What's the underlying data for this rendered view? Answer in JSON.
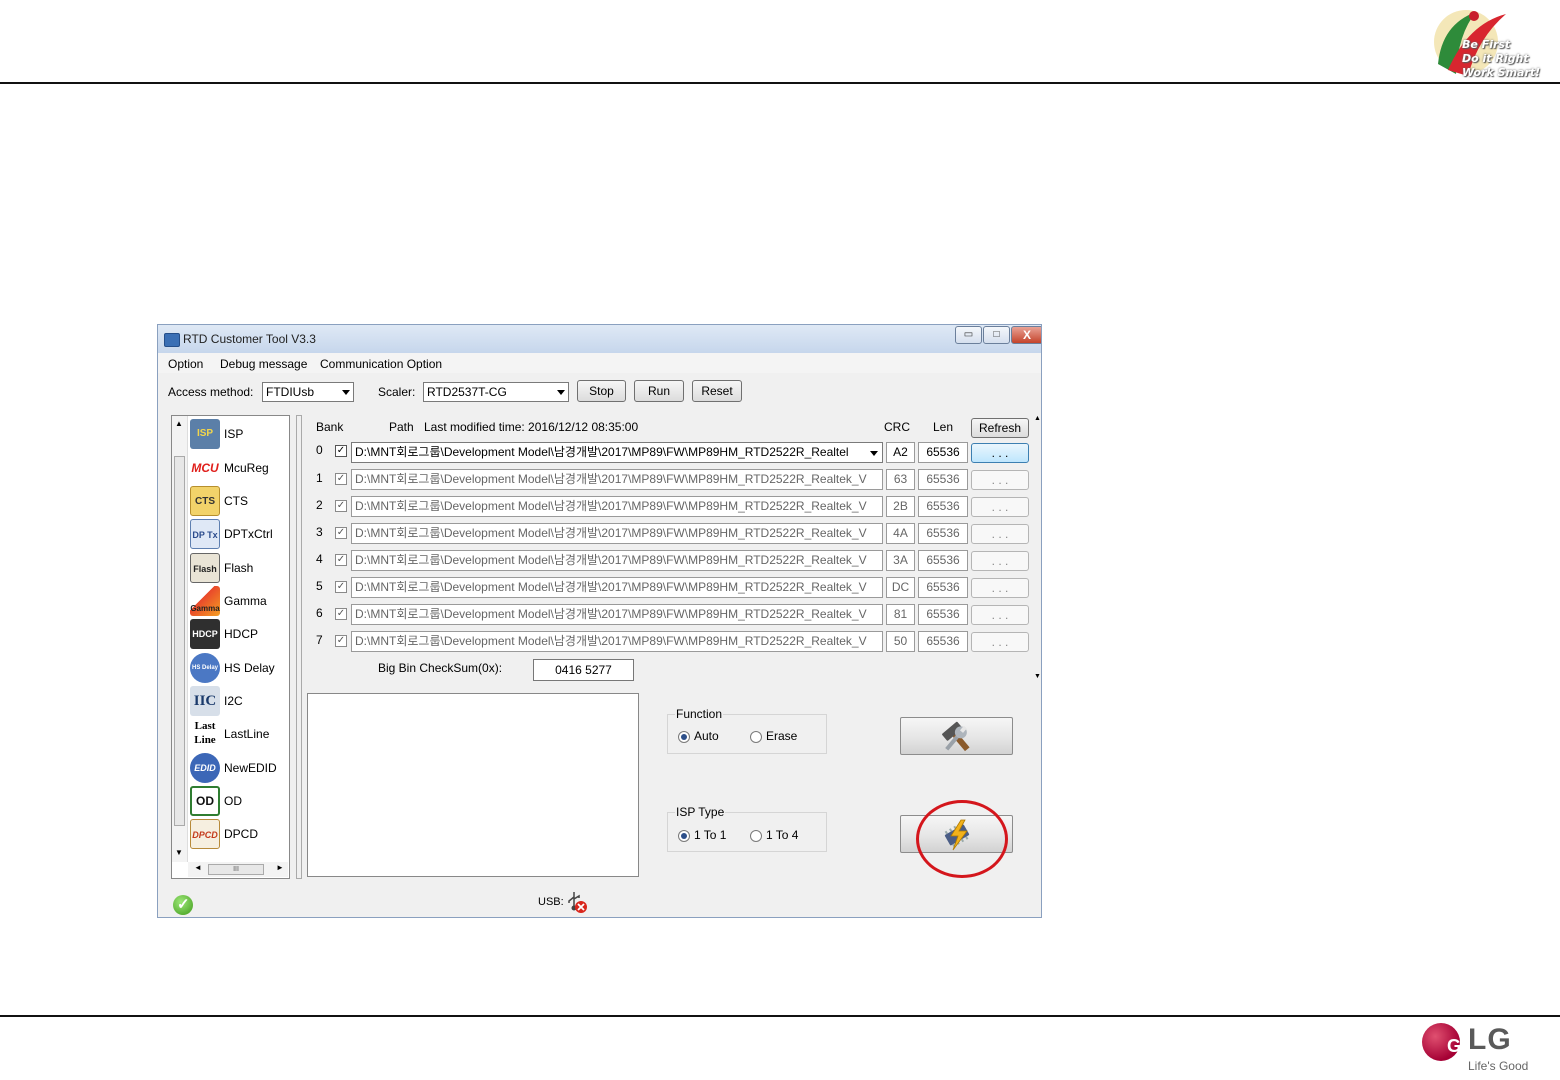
{
  "slide": {
    "slogan": [
      "Be First",
      "Do it Right",
      "Work Smart!"
    ],
    "brand": {
      "word": "LG",
      "face": "G",
      "tagline": "Life's Good"
    }
  },
  "window": {
    "title": "RTD Customer Tool V3.3",
    "controls": {
      "minimize": "▭",
      "maximize": "□",
      "close": "X"
    },
    "menu": [
      "Option",
      "Debug message",
      "Communication Option"
    ],
    "toolbar": {
      "access_label": "Access method:",
      "access_value": "FTDIUsb",
      "scaler_label": "Scaler:",
      "scaler_value": "RTD2537T-CG",
      "stop": "Stop",
      "run": "Run",
      "reset": "Reset"
    },
    "tree": {
      "items": [
        {
          "label": "ISP",
          "icon": "isp-icon"
        },
        {
          "label": "McuReg",
          "icon": "mcu-icon"
        },
        {
          "label": "CTS",
          "icon": "cts-icon"
        },
        {
          "label": "DPTxCtrl",
          "icon": "dptx-icon"
        },
        {
          "label": "Flash",
          "icon": "flash-icon"
        },
        {
          "label": "Gamma",
          "icon": "gamma-icon"
        },
        {
          "label": "HDCP",
          "icon": "hdcp-icon"
        },
        {
          "label": "HS Delay",
          "icon": "hsdelay-icon"
        },
        {
          "label": "I2C",
          "icon": "i2c-icon"
        },
        {
          "label": "LastLine",
          "icon": "lastline-icon"
        },
        {
          "label": "NewEDID",
          "icon": "edid-icon"
        },
        {
          "label": "OD",
          "icon": "od-icon"
        },
        {
          "label": "DPCD",
          "icon": "dpcd-icon"
        }
      ],
      "icon_text": [
        "ISP",
        "MCU",
        "CTS",
        "DP Tx",
        "Flash",
        "Gamma",
        "HDCP",
        "HS Delay",
        "IIC",
        "Last Line",
        "EDID",
        "OD",
        "DPCD"
      ],
      "scroll_grip": "III"
    },
    "grid": {
      "headers": {
        "bank": "Bank",
        "path": "Path",
        "modified": "Last modified time: 2016/12/12 08:35:00",
        "crc": "CRC",
        "len": "Len",
        "refresh": "Refresh"
      },
      "rows": [
        {
          "bank": "0",
          "path": "D:\\MNT회로그룹\\Development Model\\남경개발\\2017\\MP89\\FW\\MP89HM_RTD2522R_Realtel",
          "crc": "A2",
          "len": "65536",
          "browse": ". . ."
        },
        {
          "bank": "1",
          "path": "D:\\MNT회로그룹\\Development Model\\남경개발\\2017\\MP89\\FW\\MP89HM_RTD2522R_Realtek_V",
          "crc": "63",
          "len": "65536",
          "browse": ". . ."
        },
        {
          "bank": "2",
          "path": "D:\\MNT회로그룹\\Development Model\\남경개발\\2017\\MP89\\FW\\MP89HM_RTD2522R_Realtek_V",
          "crc": "2B",
          "len": "65536",
          "browse": ". . ."
        },
        {
          "bank": "3",
          "path": "D:\\MNT회로그룹\\Development Model\\남경개발\\2017\\MP89\\FW\\MP89HM_RTD2522R_Realtek_V",
          "crc": "4A",
          "len": "65536",
          "browse": ". . ."
        },
        {
          "bank": "4",
          "path": "D:\\MNT회로그룹\\Development Model\\남경개발\\2017\\MP89\\FW\\MP89HM_RTD2522R_Realtek_V",
          "crc": "3A",
          "len": "65536",
          "browse": ". . ."
        },
        {
          "bank": "5",
          "path": "D:\\MNT회로그룹\\Development Model\\남경개발\\2017\\MP89\\FW\\MP89HM_RTD2522R_Realtek_V",
          "crc": "DC",
          "len": "65536",
          "browse": ". . ."
        },
        {
          "bank": "6",
          "path": "D:\\MNT회로그룹\\Development Model\\남경개발\\2017\\MP89\\FW\\MP89HM_RTD2522R_Realtek_V",
          "crc": "81",
          "len": "65536",
          "browse": ". . ."
        },
        {
          "bank": "7",
          "path": "D:\\MNT회로그룹\\Development Model\\남경개발\\2017\\MP89\\FW\\MP89HM_RTD2522R_Realtek_V",
          "crc": "50",
          "len": "65536",
          "browse": ". . ."
        }
      ],
      "checksum_label": "Big Bin CheckSum(0x):",
      "checksum_value": "0416 5277"
    },
    "function_group": {
      "title": "Function",
      "options": [
        "Auto",
        "Erase"
      ],
      "selected": "Auto"
    },
    "isp_type_group": {
      "title": "ISP Type",
      "options": [
        "1 To 1",
        "1 To 4"
      ],
      "selected": "1 To 1"
    },
    "status": {
      "usb_label": "USB:"
    }
  },
  "colors": {
    "highlight_circle": "#d4161c",
    "lg_red": "#a50034"
  }
}
